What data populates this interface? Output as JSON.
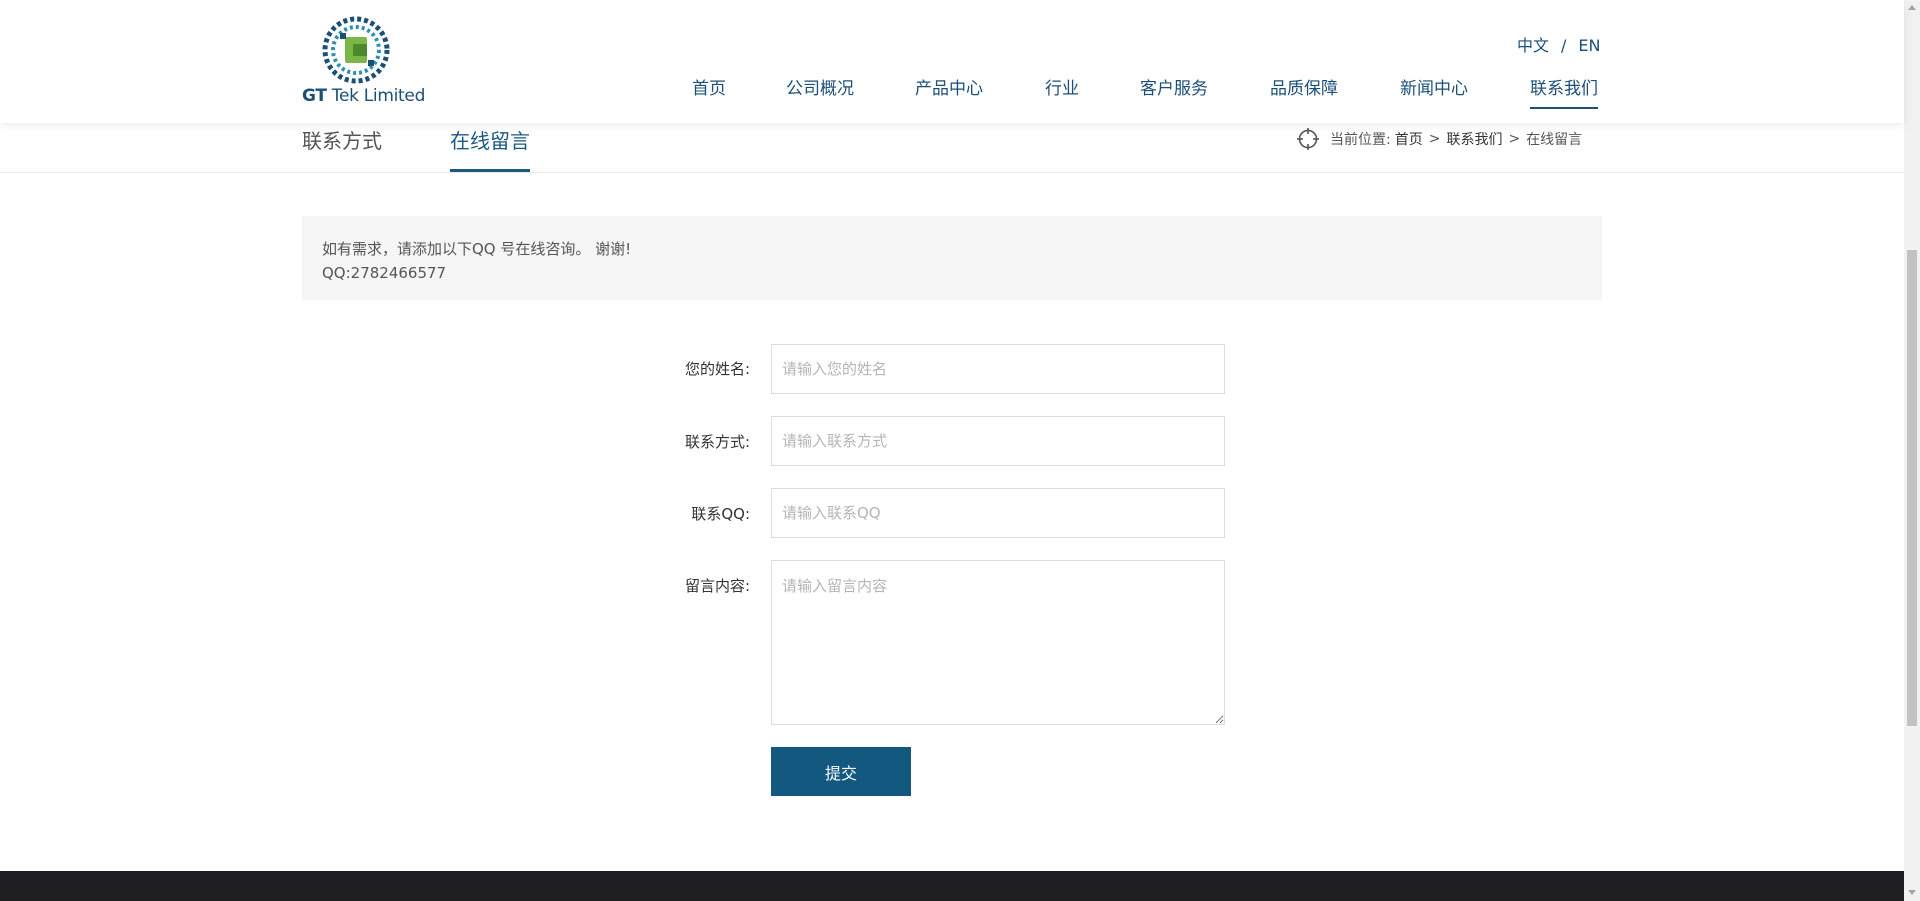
{
  "brand": {
    "logo_text_bold": "GT",
    "logo_text_rest": " Tek Limited",
    "colors": {
      "primary": "#1b4f78",
      "accent_green": "#7ab648",
      "button": "#12587f",
      "footer": "#1e1e22"
    }
  },
  "lang": {
    "zh": "中文",
    "sep": "/",
    "en": "EN"
  },
  "nav": {
    "items": [
      {
        "label": "首页"
      },
      {
        "label": "公司概况"
      },
      {
        "label": "产品中心"
      },
      {
        "label": "行业"
      },
      {
        "label": "客户服务"
      },
      {
        "label": "品质保障"
      },
      {
        "label": "新闻中心"
      },
      {
        "label": "联系我们"
      }
    ],
    "active_index": 7
  },
  "subnav": {
    "tabs": [
      {
        "label": "联系方式"
      },
      {
        "label": "在线留言"
      }
    ],
    "active_index": 1
  },
  "breadcrumb": {
    "prefix": "当前位置:",
    "items": [
      {
        "label": "首页"
      },
      {
        "label": "联系我们"
      },
      {
        "label": "在线留言"
      }
    ],
    "arrow": ">",
    "icon": "crosshair-icon"
  },
  "notice": {
    "line1": "如有需求，请添加以下QQ 号在线咨询。 谢谢!",
    "line2": "QQ:2782466577"
  },
  "form": {
    "name": {
      "label": "您的姓名:",
      "placeholder": "请输入您的姓名",
      "value": ""
    },
    "contact": {
      "label": "联系方式:",
      "placeholder": "请输入联系方式",
      "value": ""
    },
    "qq": {
      "label": "联系QQ:",
      "placeholder": "请输入联系QQ",
      "value": ""
    },
    "message": {
      "label": "留言内容:",
      "placeholder": "请输入留言内容",
      "value": ""
    },
    "submit_label": "提交"
  }
}
